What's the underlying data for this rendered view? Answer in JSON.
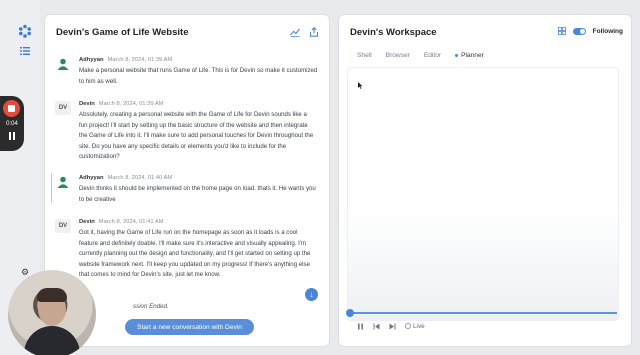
{
  "recorder": {
    "time": "0:04"
  },
  "left_panel": {
    "title": "Devin's Game of Life Website",
    "messages": [
      {
        "author": "Adhyyan",
        "avatar": "user",
        "time": "March 8, 2024, 01:39 AM",
        "lines": [
          "Make a personal website that runs Game of Life. This is for Devin so make it customized",
          "to him as well."
        ]
      },
      {
        "author": "Devin",
        "avatar": "DV",
        "time": "March 8, 2024, 01:39 AM",
        "lines": [
          "Absolutely, creating a personal website with the Game of Life for Devin sounds like a",
          "fun project! I'll start by setting up the basic structure of the website and then integrate",
          "the Game of Life into it. I'll make sure to add personal touches for Devin throughout the",
          "site. Do you have any specific details or elements you'd like to include for the",
          "customization?"
        ]
      },
      {
        "author": "Adhyyan",
        "avatar": "user",
        "time": "March 8, 2024, 01:40 AM",
        "lines": [
          "Devin thinks it should be implemented on the home page on load. thats it. He wants you",
          "to be creative"
        ]
      },
      {
        "author": "Devin",
        "avatar": "DV",
        "time": "March 8, 2024, 01:41 AM",
        "lines": [
          "Got it, having the Game of Life run on the homepage as soon as it loads is a cool",
          "feature and definitely doable. I'll make sure it's interactive and visually appealing. I'm",
          "currently planning out the design and functionality, and I'll get started on setting up the",
          "website framework next. I'll keep you updated on my progress! If there's anything else",
          "that comes to mind for Devin's site, just let me know."
        ]
      }
    ],
    "session_ended": "ssion Ended.",
    "new_conversation_label": "Start a new conversation with Devin"
  },
  "right_panel": {
    "title": "Devin's Workspace",
    "following_label": "Following",
    "tabs": [
      "Shell",
      "Browser",
      "Editor",
      "Planner"
    ],
    "active_tab": "Planner",
    "live_label": "Live"
  },
  "colors": {
    "accent": "#4b86d6",
    "record": "#e34b3c",
    "background": "#e9eaed"
  }
}
